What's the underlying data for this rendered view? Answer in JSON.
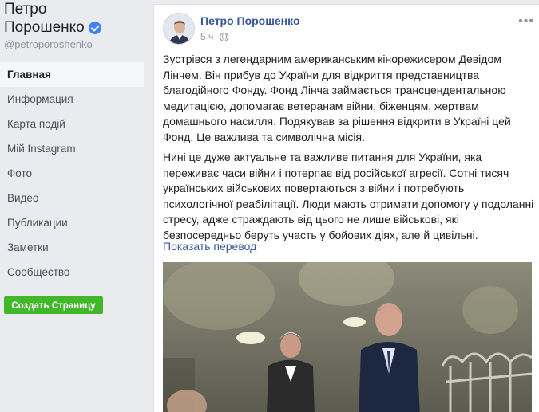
{
  "sidebar": {
    "page_name_line1": "Петро",
    "page_name_line2": "Порошенко",
    "handle": "@petroporoshenko",
    "nav": [
      {
        "label": "Главная",
        "active": true
      },
      {
        "label": "Информация"
      },
      {
        "label": "Карта подій"
      },
      {
        "label": "Мій Instagram"
      },
      {
        "label": "Фото"
      },
      {
        "label": "Видео"
      },
      {
        "label": "Публикации"
      },
      {
        "label": "Заметки"
      },
      {
        "label": "Сообщество"
      }
    ],
    "create_page_label": "Создать Страницу"
  },
  "post": {
    "author": "Петро Порошенко",
    "time": "5 ч",
    "more_glyph": "•••",
    "paragraph1": "Зустрівся з легендарним американським кінорежисером Девідом Лінчем. Він прибув до України для відкриття представництва благодійного Фонду. Фонд Лінча займається трансцендентальною медитацією, допомагає ветеранам війни, біженцям, жертвам домашнього насилля. Подякував за рішення відкрити в Україні цей Фонд. Це важлива та символічна місія.",
    "paragraph2": "Нині це дуже актуальне та важливе питання для України, яка переживає часи війни і потерпає від російської агресії. Сотні тисяч українських військових повертаються з війни і потребують психологічної реабілітації. Люди мають отримати допомогу у подоланні стресу, адже страждають від цього не лише військові, які безпосередньо беруть участь у бойових діях, але й цивільні.",
    "translate_label": "Показать перевод"
  },
  "colors": {
    "link": "#365899",
    "create_button": "#42b72a",
    "verified": "#4080ff"
  }
}
